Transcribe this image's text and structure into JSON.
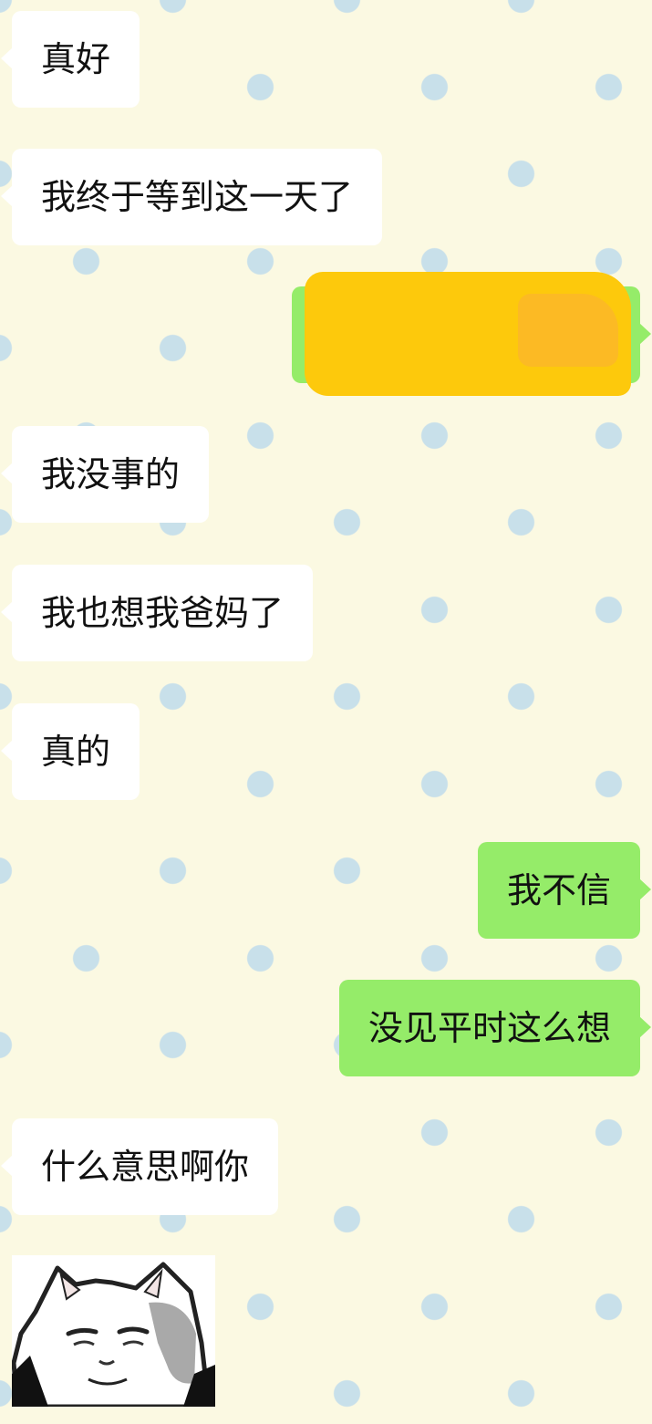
{
  "messages": [
    {
      "direction": "incoming",
      "text": "真好"
    },
    {
      "direction": "incoming",
      "text": "我终于等到这一天了"
    },
    {
      "direction": "outgoing",
      "text": "",
      "redacted": true,
      "redaction_color": "#fdc90c"
    },
    {
      "direction": "incoming",
      "text": "我没事的"
    },
    {
      "direction": "incoming",
      "text": "我也想我爸妈了"
    },
    {
      "direction": "incoming",
      "text": "真的"
    },
    {
      "direction": "outgoing",
      "text": "我不信"
    },
    {
      "direction": "outgoing",
      "text": "没见平时这么想"
    },
    {
      "direction": "incoming",
      "text": "什么意思啊你"
    },
    {
      "direction": "incoming",
      "type": "sticker",
      "icon": "cat-meme-sticker"
    }
  ],
  "colors": {
    "background": "#fbf9e2",
    "dots": "#c8e0ea",
    "incoming_bubble": "#ffffff",
    "outgoing_bubble": "#95ec69"
  }
}
